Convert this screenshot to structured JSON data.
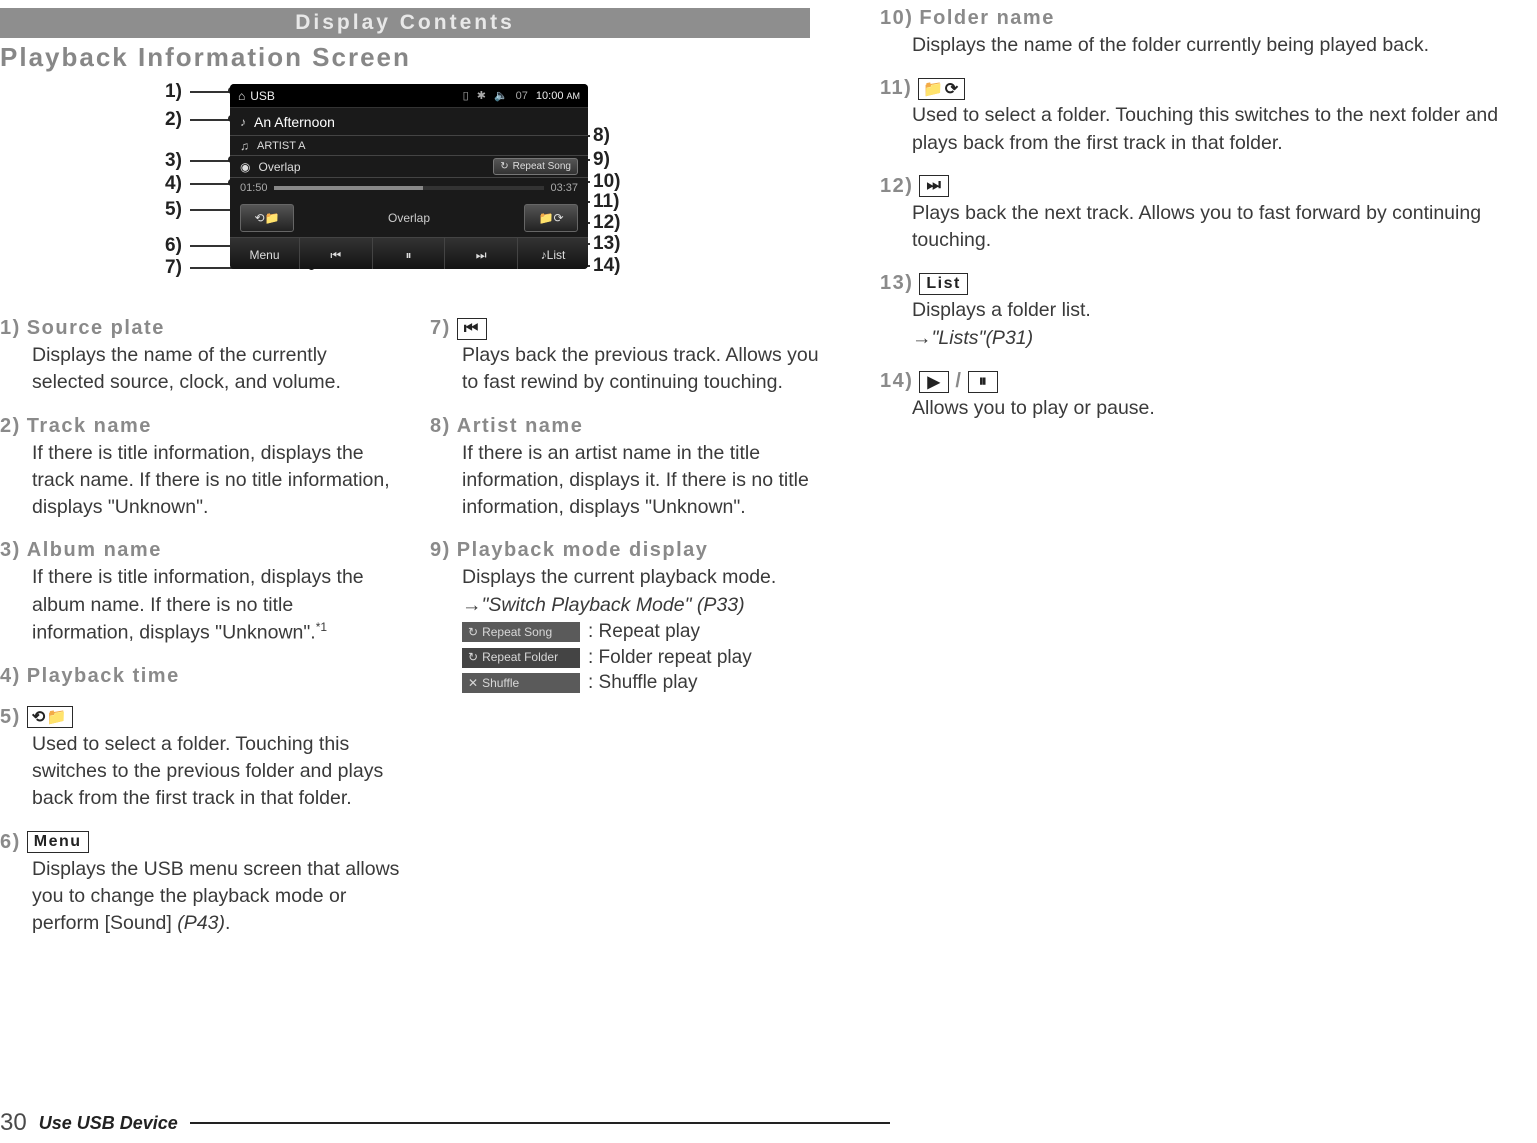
{
  "header": {
    "title_bar": "Display Contents",
    "section": "Playback Information Screen"
  },
  "footer": {
    "page_number": "30",
    "title": "Use USB Device"
  },
  "device": {
    "source": "USB",
    "vol": "07",
    "clock": "10:00",
    "clock_ampm": "AM",
    "track": "An Afternoon",
    "artist": "ARTIST A",
    "album": "Overlap",
    "time_elapsed": "01:50",
    "time_total": "03:37",
    "mode": "Repeat Song",
    "folder_name": "Overlap",
    "menu": "Menu",
    "list": "List"
  },
  "callouts_left": [
    "1)",
    "2)",
    "3)",
    "4)",
    "5)",
    "6)",
    "7)"
  ],
  "callouts_right": [
    "8)",
    "9)",
    "10)",
    "11)",
    "12)",
    "13)",
    "14)"
  ],
  "items": {
    "i1": {
      "num": "1)",
      "title": "Source plate",
      "body": "Displays the name of the currently selected source, clock, and volume."
    },
    "i2": {
      "num": "2)",
      "title": "Track name",
      "body": "If there is title information, displays the track name. If there is no title information, displays \"Unknown\"."
    },
    "i3": {
      "num": "3)",
      "title": "Album name",
      "body": "If there is title information, displays the album name. If there is no title information, displays \"Unknown\".",
      "sup": "*1"
    },
    "i4": {
      "num": "4)",
      "title": "Playback time",
      "body": ""
    },
    "i5": {
      "num": "5)",
      "body": "Used to select a folder. Touching this switches to the previous folder and plays back from the first track in that folder."
    },
    "i6": {
      "num": "6)",
      "button": "Menu",
      "body_a": "Displays the USB menu screen that allows you to change the playback mode or perform [Sound] ",
      "body_ref": "(P43)",
      "body_b": "."
    },
    "i7": {
      "num": "7)",
      "body": "Plays back the previous track. Allows you to fast rewind by continuing touching."
    },
    "i8": {
      "num": "8)",
      "title": "Artist name",
      "body": "If there is an artist name in the title information, displays it. If there is no title information, displays \"Unknown\"."
    },
    "i9": {
      "num": "9)",
      "title": "Playback mode display",
      "body": "Displays the current playback mode.",
      "ref": "→\"Switch Playback Mode\" (P33)",
      "mode1": "Repeat Song",
      "mode1_label": ": Repeat play",
      "mode2": "Repeat Folder",
      "mode2_label": ": Folder repeat play",
      "mode3": "Shuffle",
      "mode3_label": ": Shuffle play"
    },
    "i10": {
      "num": "10)",
      "title": "Folder name",
      "body": "Displays the name of the folder currently being played back."
    },
    "i11": {
      "num": "11)",
      "body": "Used to select a folder. Touching this switches to the next folder and plays back from the first track in that folder."
    },
    "i12": {
      "num": "12)",
      "body": "Plays back the next track. Allows you to fast forward by continuing touching."
    },
    "i13": {
      "num": "13)",
      "button": "List",
      "body": "Displays a folder list.",
      "ref": "→\"Lists\"(P31)"
    },
    "i14": {
      "num": "14)",
      "body": "Allows you to play or pause.",
      "sep": " / "
    }
  }
}
